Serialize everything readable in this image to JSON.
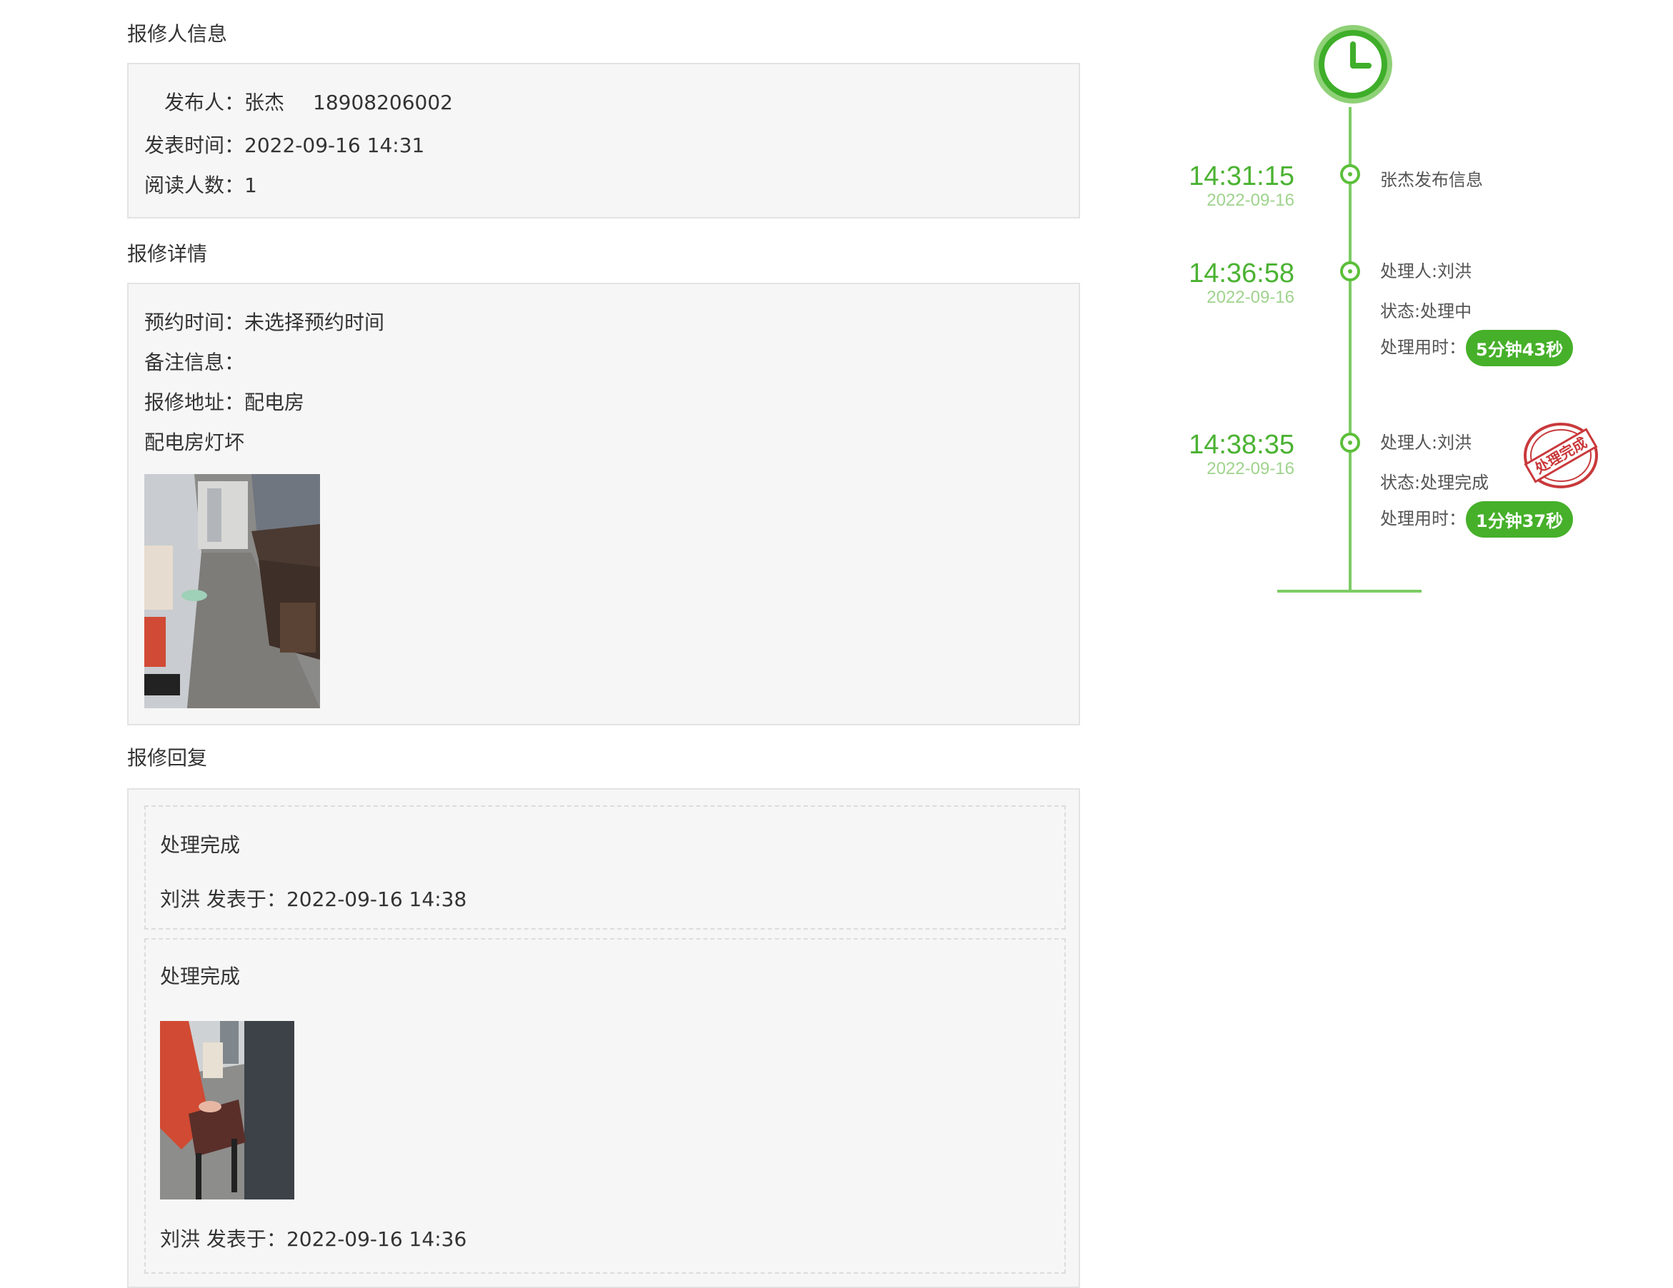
{
  "reporter_section": {
    "title": "报修人信息",
    "publisher_label": "发布人：",
    "publisher_name": "张杰",
    "publisher_phone": "18908206002",
    "publish_time_label": "发表时间：",
    "publish_time": "2022-09-16 14:31",
    "read_count_label": "阅读人数：",
    "read_count": "1"
  },
  "detail_section": {
    "title": "报修详情",
    "appointment_label": "预约时间：",
    "appointment_value": "未选择预约时间",
    "remark_label": "备注信息：",
    "remark_value": "",
    "address_label": "报修地址：",
    "address_value": "配电房",
    "description": "配电房灯坏"
  },
  "reply_section": {
    "title": "报修回复",
    "replies": [
      {
        "status": "处理完成",
        "author": "刘洪",
        "posted_label": "发表于：",
        "posted_time": "2022-09-16 14:38"
      },
      {
        "status": "处理完成",
        "author": "刘洪",
        "posted_label": "发表于：",
        "posted_time": "2022-09-16 14:36"
      }
    ]
  },
  "timeline": {
    "events": [
      {
        "time": "14:31:15",
        "date": "2022-09-16",
        "text": "张杰发布信息"
      },
      {
        "time": "14:36:58",
        "date": "2022-09-16",
        "handler": "处理人:刘洪",
        "status": "状态:处理中",
        "duration_label": "处理用时：",
        "duration": "5分钟43秒"
      },
      {
        "time": "14:38:35",
        "date": "2022-09-16",
        "handler": "处理人:刘洪",
        "status": "状态:处理完成",
        "duration_label": "处理用时：",
        "duration": "1分钟37秒",
        "stamp": "处理完成"
      }
    ]
  },
  "colors": {
    "accent": "#4bb232",
    "stamp": "#c9393b"
  }
}
